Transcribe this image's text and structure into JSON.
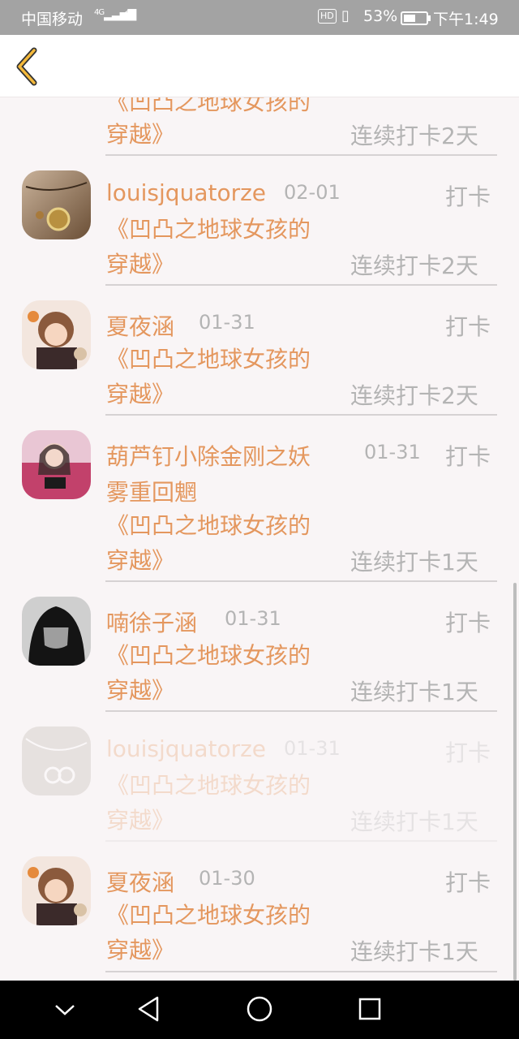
{
  "status_bar": {
    "carrier": "中国移动",
    "network": "4G",
    "battery_percent": "53%",
    "time": "下午1:49",
    "hd_badge": "HD"
  },
  "header": {
    "back_icon": "chevron-left-icon",
    "accent": "#f4b93b"
  },
  "top_partial": {
    "book_tail": "《凹凸之地球女孩的",
    "book_line2": "穿越》",
    "streak": "连续打卡2天"
  },
  "records": [
    {
      "name": "louisjquatorze",
      "date": "02-01",
      "action": "打卡",
      "book_line1": "《凹凸之地球女孩的",
      "book_line2": "穿越》",
      "streak": "连续打卡2天"
    },
    {
      "name": "夏夜涵",
      "date": "01-31",
      "action": "打卡",
      "book_line1": "《凹凸之地球女孩的",
      "book_line2": "穿越》",
      "streak": "连续打卡2天"
    },
    {
      "name": "葫芦钉小除金刚之妖",
      "name_line2": "雾重回魍",
      "date": "01-31",
      "action": "打卡",
      "book_line1": "《凹凸之地球女孩的",
      "book_line2": "穿越》",
      "streak": "连续打卡1天"
    },
    {
      "name": "喃徐子涵",
      "date": "01-31",
      "action": "打卡",
      "book_line1": "《凹凸之地球女孩的",
      "book_line2": "穿越》",
      "streak": "连续打卡1天"
    },
    {
      "name": "louisjquatorze",
      "date": "01-31",
      "action": "打卡",
      "book_line1": "《凹凸之地球女孩的",
      "book_line2": "穿越》",
      "streak": "连续打卡1天"
    },
    {
      "name": "夏夜涵",
      "date": "01-30",
      "action": "打卡",
      "book_line1": "《凹凸之地球女孩的",
      "book_line2": "穿越》",
      "streak": "连续打卡1天"
    }
  ],
  "nav_bar": {
    "icons": [
      "chevron-down-icon",
      "back-triangle-icon",
      "home-circle-icon",
      "recents-square-icon"
    ]
  },
  "colors": {
    "name": "#e4975e",
    "muted": "#b4b4b4",
    "background": "#f9f5f6"
  }
}
